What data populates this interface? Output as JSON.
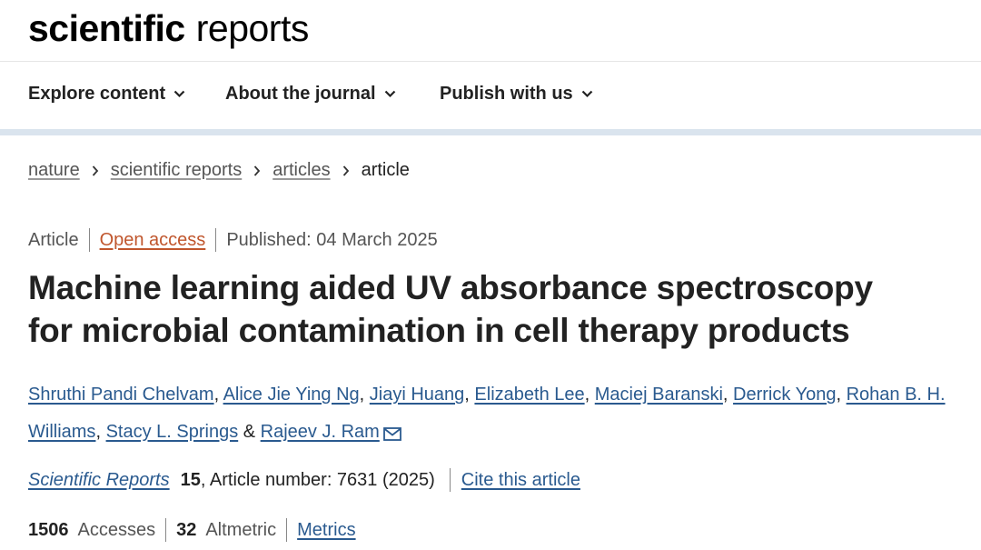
{
  "brand": {
    "bold": "scientific",
    "regular": "reports"
  },
  "nav": {
    "items": [
      {
        "label": "Explore content"
      },
      {
        "label": "About the journal"
      },
      {
        "label": "Publish with us"
      }
    ]
  },
  "breadcrumb": {
    "items": [
      "nature",
      "scientific reports",
      "articles"
    ],
    "current": "article"
  },
  "meta": {
    "type": "Article",
    "access": "Open access",
    "published": "Published: 04 March 2025"
  },
  "article": {
    "title_line1": "Machine learning aided UV absorbance spectroscopy",
    "title_line2": "for microbial contamination in cell therapy products"
  },
  "authors": [
    "Shruthi Pandi Chelvam",
    "Alice Jie Ying Ng",
    "Jiayi Huang",
    "Elizabeth Lee",
    "Maciej Baranski",
    "Derrick Yong",
    "Rohan B. H. Williams",
    "Stacy L. Springs",
    "Rajeev J. Ram"
  ],
  "authors_connector": "&",
  "citation": {
    "journal": "Scientific Reports",
    "volume": "15",
    "article_number": ", Article number: 7631 (2025)",
    "cite_label": "Cite this article"
  },
  "metrics": {
    "accesses_count": "1506",
    "accesses_label": "Accesses",
    "altmetric_count": "32",
    "altmetric_label": "Altmetric",
    "metrics_link": "Metrics"
  },
  "colors": {
    "link_blue": "#2a5a8f",
    "open_access_orange": "#c0562d",
    "nav_divider": "#dae4ee"
  }
}
